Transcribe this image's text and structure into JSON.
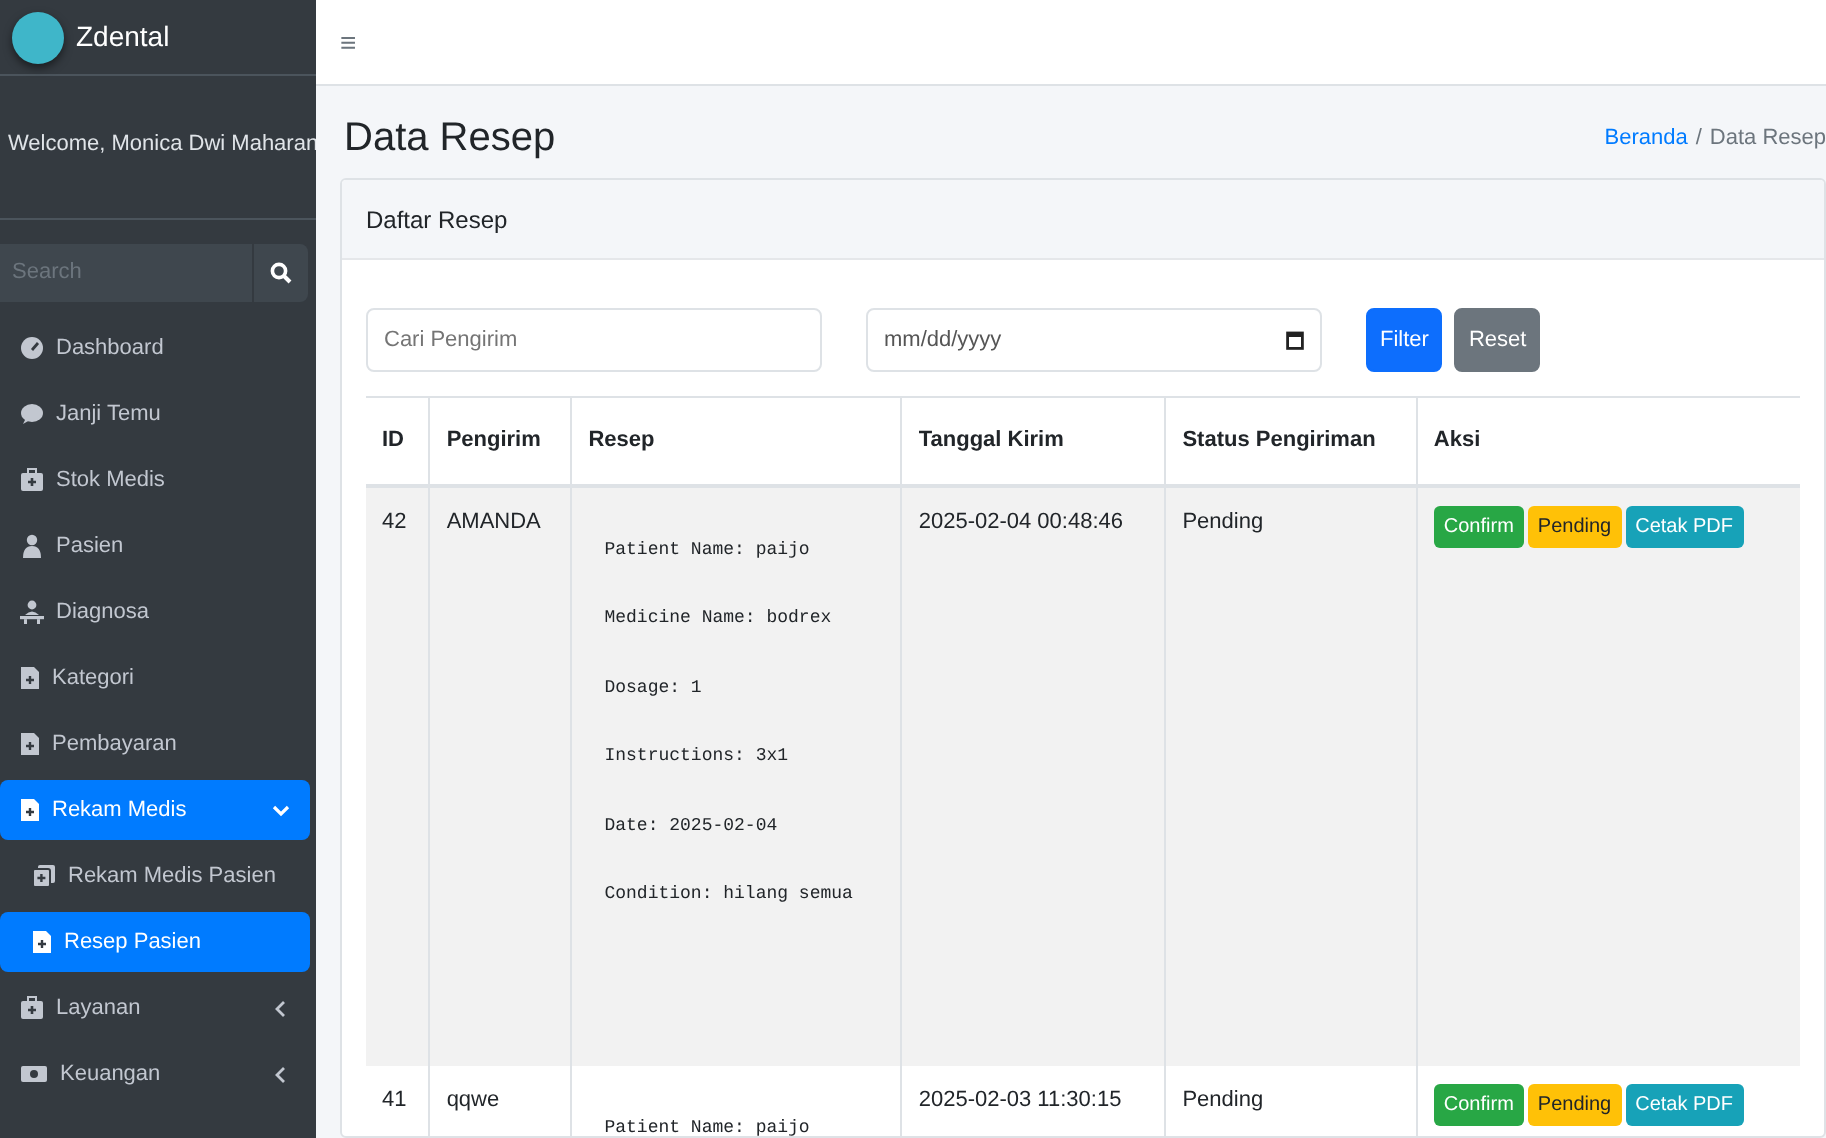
{
  "sidebar": {
    "brand": "Zdental",
    "welcome": "Welcome, Monica Dwi Maharan",
    "search": {
      "placeholder": "Search"
    },
    "items": [
      {
        "label": "Dashboard",
        "selected": false
      },
      {
        "label": "Janji Temu",
        "selected": false
      },
      {
        "label": "Stok Medis",
        "selected": false
      },
      {
        "label": "Pasien",
        "selected": false
      },
      {
        "label": "Diagnosa",
        "selected": false
      },
      {
        "label": "Kategori",
        "selected": false
      },
      {
        "label": "Pembayaran",
        "selected": false
      },
      {
        "label": "Rekam Medis",
        "selected": true,
        "expanded": true,
        "children": [
          {
            "label": "Rekam Medis Pasien",
            "selected": false
          },
          {
            "label": "Resep Pasien",
            "selected": true
          }
        ]
      },
      {
        "label": "Layanan",
        "selected": false,
        "expanded": false
      },
      {
        "label": "Keuangan",
        "selected": false,
        "expanded": false
      }
    ]
  },
  "topbar": {
    "menu_glyph": "≡"
  },
  "page_title": "Data Resep",
  "breadcrumb": {
    "separator": "/",
    "items": [
      {
        "label": "Beranda",
        "link": true
      },
      {
        "label": "Data Resep",
        "link": false
      }
    ]
  },
  "card": {
    "title": "Daftar Resep",
    "filters": {
      "search": {
        "placeholder": "Cari Pengirim"
      },
      "date": {
        "placeholder": "mm/dd/yyyy"
      },
      "buttons": [
        {
          "label": "Filter",
          "kind": "primary"
        },
        {
          "label": "Reset",
          "kind": "secondary"
        }
      ]
    },
    "table": {
      "columns": [
        "ID",
        "Pengirim",
        "Resep",
        "Tanggal Kirim",
        "Status Pengiriman",
        "Aksi"
      ],
      "rows": [
        {
          "id": "42",
          "sender": "AMANDA",
          "recipe": [
            "Patient Name: paijo",
            "Medicine Name: bodrex",
            "Dosage: 1",
            "Instructions: 3x1",
            "Date: 2025-02-04",
            "Condition: hilang semua"
          ],
          "sent": "2025-02-04 00:48:46",
          "status": "Pending",
          "actions": [
            {
              "label": "Confirm",
              "kind": "success"
            },
            {
              "label": "Pending",
              "kind": "warning"
            },
            {
              "label": "Cetak PDF",
              "kind": "info"
            }
          ]
        },
        {
          "id": "41",
          "sender": "qqwe",
          "recipe": [
            "Patient Name: paijo"
          ],
          "sent": "2025-02-03 11:30:15",
          "status": "Pending",
          "actions": [
            {
              "label": "Confirm",
              "kind": "success"
            },
            {
              "label": "Pending",
              "kind": "warning"
            },
            {
              "label": "Cetak PDF",
              "kind": "info"
            }
          ]
        }
      ]
    }
  }
}
